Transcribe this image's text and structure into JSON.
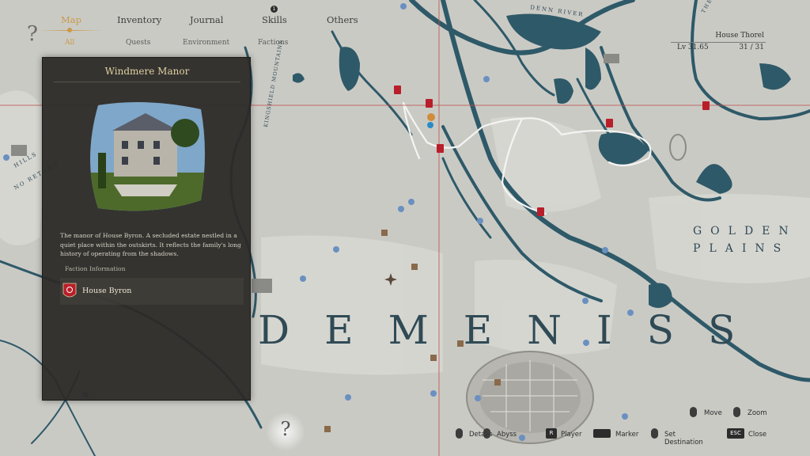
{
  "nav": {
    "tabs": [
      "Map",
      "Inventory",
      "Journal",
      "Skills",
      "Others"
    ],
    "skills_badge": "1",
    "subtabs": [
      "All",
      "Quests",
      "Environment",
      "Factions"
    ]
  },
  "help_icon": "?",
  "panel": {
    "title": "Windmere Manor",
    "description": "The manor of House Byron. A secluded estate nestled in a quiet place within the outskirts. It reflects the family's long history of operating from the shadows.",
    "section_label": "Faction Information",
    "faction_name": "House Byron"
  },
  "house": {
    "name": "House Thorel",
    "level": "Lv 31.65",
    "members": "31 / 31"
  },
  "map_labels": {
    "region_big": "DEMENISS",
    "golden": "GOLDEN",
    "plains": "PLAINS",
    "mountains": "KINGSHIELD MOUNTAINS",
    "river": "DENN RIVER",
    "hills": "HILLS",
    "no_return": "NO RETURN",
    "crim": "THE CRIM"
  },
  "controls": {
    "details": "Details",
    "abyss": "Abyss",
    "player_key": "R",
    "player": "Player",
    "marker": "Marker",
    "set_destination": "Set Destination",
    "esc_key": "ESC",
    "close": "Close",
    "move": "Move",
    "zoom": "Zoom"
  },
  "colors": {
    "accent_gold": "#c99a4a",
    "water": "#2e5968",
    "land": "#c9c9c4",
    "panel_bg": "#2b2a28"
  }
}
